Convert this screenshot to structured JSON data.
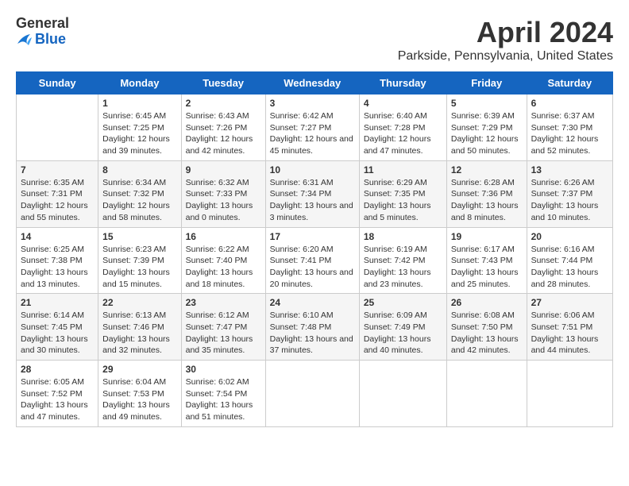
{
  "header": {
    "logo_general": "General",
    "logo_blue": "Blue",
    "title": "April 2024",
    "subtitle": "Parkside, Pennsylvania, United States"
  },
  "calendar": {
    "days_of_week": [
      "Sunday",
      "Monday",
      "Tuesday",
      "Wednesday",
      "Thursday",
      "Friday",
      "Saturday"
    ],
    "weeks": [
      [
        {
          "day": "",
          "sunrise": "",
          "sunset": "",
          "daylight": ""
        },
        {
          "day": "1",
          "sunrise": "Sunrise: 6:45 AM",
          "sunset": "Sunset: 7:25 PM",
          "daylight": "Daylight: 12 hours and 39 minutes."
        },
        {
          "day": "2",
          "sunrise": "Sunrise: 6:43 AM",
          "sunset": "Sunset: 7:26 PM",
          "daylight": "Daylight: 12 hours and 42 minutes."
        },
        {
          "day": "3",
          "sunrise": "Sunrise: 6:42 AM",
          "sunset": "Sunset: 7:27 PM",
          "daylight": "Daylight: 12 hours and 45 minutes."
        },
        {
          "day": "4",
          "sunrise": "Sunrise: 6:40 AM",
          "sunset": "Sunset: 7:28 PM",
          "daylight": "Daylight: 12 hours and 47 minutes."
        },
        {
          "day": "5",
          "sunrise": "Sunrise: 6:39 AM",
          "sunset": "Sunset: 7:29 PM",
          "daylight": "Daylight: 12 hours and 50 minutes."
        },
        {
          "day": "6",
          "sunrise": "Sunrise: 6:37 AM",
          "sunset": "Sunset: 7:30 PM",
          "daylight": "Daylight: 12 hours and 52 minutes."
        }
      ],
      [
        {
          "day": "7",
          "sunrise": "Sunrise: 6:35 AM",
          "sunset": "Sunset: 7:31 PM",
          "daylight": "Daylight: 12 hours and 55 minutes."
        },
        {
          "day": "8",
          "sunrise": "Sunrise: 6:34 AM",
          "sunset": "Sunset: 7:32 PM",
          "daylight": "Daylight: 12 hours and 58 minutes."
        },
        {
          "day": "9",
          "sunrise": "Sunrise: 6:32 AM",
          "sunset": "Sunset: 7:33 PM",
          "daylight": "Daylight: 13 hours and 0 minutes."
        },
        {
          "day": "10",
          "sunrise": "Sunrise: 6:31 AM",
          "sunset": "Sunset: 7:34 PM",
          "daylight": "Daylight: 13 hours and 3 minutes."
        },
        {
          "day": "11",
          "sunrise": "Sunrise: 6:29 AM",
          "sunset": "Sunset: 7:35 PM",
          "daylight": "Daylight: 13 hours and 5 minutes."
        },
        {
          "day": "12",
          "sunrise": "Sunrise: 6:28 AM",
          "sunset": "Sunset: 7:36 PM",
          "daylight": "Daylight: 13 hours and 8 minutes."
        },
        {
          "day": "13",
          "sunrise": "Sunrise: 6:26 AM",
          "sunset": "Sunset: 7:37 PM",
          "daylight": "Daylight: 13 hours and 10 minutes."
        }
      ],
      [
        {
          "day": "14",
          "sunrise": "Sunrise: 6:25 AM",
          "sunset": "Sunset: 7:38 PM",
          "daylight": "Daylight: 13 hours and 13 minutes."
        },
        {
          "day": "15",
          "sunrise": "Sunrise: 6:23 AM",
          "sunset": "Sunset: 7:39 PM",
          "daylight": "Daylight: 13 hours and 15 minutes."
        },
        {
          "day": "16",
          "sunrise": "Sunrise: 6:22 AM",
          "sunset": "Sunset: 7:40 PM",
          "daylight": "Daylight: 13 hours and 18 minutes."
        },
        {
          "day": "17",
          "sunrise": "Sunrise: 6:20 AM",
          "sunset": "Sunset: 7:41 PM",
          "daylight": "Daylight: 13 hours and 20 minutes."
        },
        {
          "day": "18",
          "sunrise": "Sunrise: 6:19 AM",
          "sunset": "Sunset: 7:42 PM",
          "daylight": "Daylight: 13 hours and 23 minutes."
        },
        {
          "day": "19",
          "sunrise": "Sunrise: 6:17 AM",
          "sunset": "Sunset: 7:43 PM",
          "daylight": "Daylight: 13 hours and 25 minutes."
        },
        {
          "day": "20",
          "sunrise": "Sunrise: 6:16 AM",
          "sunset": "Sunset: 7:44 PM",
          "daylight": "Daylight: 13 hours and 28 minutes."
        }
      ],
      [
        {
          "day": "21",
          "sunrise": "Sunrise: 6:14 AM",
          "sunset": "Sunset: 7:45 PM",
          "daylight": "Daylight: 13 hours and 30 minutes."
        },
        {
          "day": "22",
          "sunrise": "Sunrise: 6:13 AM",
          "sunset": "Sunset: 7:46 PM",
          "daylight": "Daylight: 13 hours and 32 minutes."
        },
        {
          "day": "23",
          "sunrise": "Sunrise: 6:12 AM",
          "sunset": "Sunset: 7:47 PM",
          "daylight": "Daylight: 13 hours and 35 minutes."
        },
        {
          "day": "24",
          "sunrise": "Sunrise: 6:10 AM",
          "sunset": "Sunset: 7:48 PM",
          "daylight": "Daylight: 13 hours and 37 minutes."
        },
        {
          "day": "25",
          "sunrise": "Sunrise: 6:09 AM",
          "sunset": "Sunset: 7:49 PM",
          "daylight": "Daylight: 13 hours and 40 minutes."
        },
        {
          "day": "26",
          "sunrise": "Sunrise: 6:08 AM",
          "sunset": "Sunset: 7:50 PM",
          "daylight": "Daylight: 13 hours and 42 minutes."
        },
        {
          "day": "27",
          "sunrise": "Sunrise: 6:06 AM",
          "sunset": "Sunset: 7:51 PM",
          "daylight": "Daylight: 13 hours and 44 minutes."
        }
      ],
      [
        {
          "day": "28",
          "sunrise": "Sunrise: 6:05 AM",
          "sunset": "Sunset: 7:52 PM",
          "daylight": "Daylight: 13 hours and 47 minutes."
        },
        {
          "day": "29",
          "sunrise": "Sunrise: 6:04 AM",
          "sunset": "Sunset: 7:53 PM",
          "daylight": "Daylight: 13 hours and 49 minutes."
        },
        {
          "day": "30",
          "sunrise": "Sunrise: 6:02 AM",
          "sunset": "Sunset: 7:54 PM",
          "daylight": "Daylight: 13 hours and 51 minutes."
        },
        {
          "day": "",
          "sunrise": "",
          "sunset": "",
          "daylight": ""
        },
        {
          "day": "",
          "sunrise": "",
          "sunset": "",
          "daylight": ""
        },
        {
          "day": "",
          "sunrise": "",
          "sunset": "",
          "daylight": ""
        },
        {
          "day": "",
          "sunrise": "",
          "sunset": "",
          "daylight": ""
        }
      ]
    ]
  }
}
